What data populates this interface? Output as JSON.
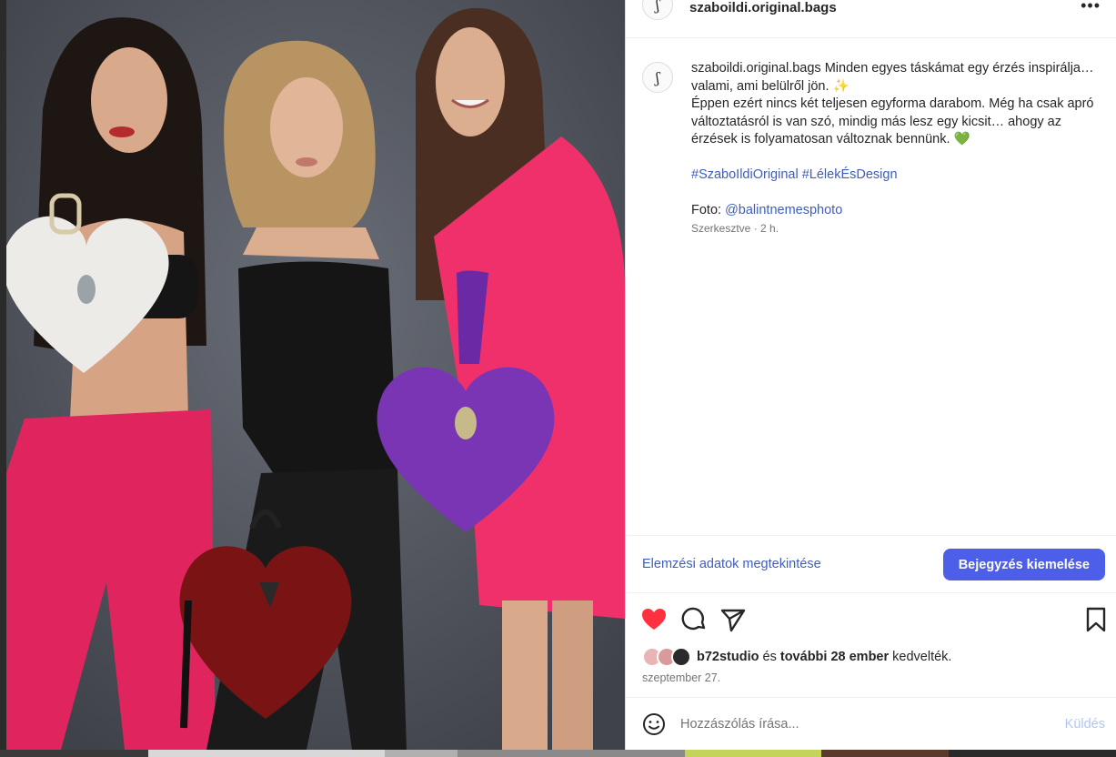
{
  "post": {
    "username": "szaboildi.original.bags",
    "avatar_glyph": "ʃ",
    "more_icon": "more-horizontal-icon"
  },
  "caption": {
    "username": "szaboildi.original.bags",
    "line1": "Minden egyes táskámat egy érzés inspirálja… valami, ami belülről jön. ✨",
    "line2": "Éppen ezért nincs két teljesen egyforma darabom. Még ha csak apró változtatásról is van szó, mindig más lesz egy kicsit… ahogy az érzések is folyamatosan változnak bennünk. 💚",
    "hashtag1": "#SzaboIldiOriginal",
    "hashtag2": "#LélekÉsDesign",
    "photo_prefix": "Foto:",
    "photo_credit": "@balintnemesphoto",
    "edited": "Szerkesztve",
    "sep": "·",
    "time_ago": "2 h."
  },
  "insights": {
    "view_label": "Elemzési adatok megtekintése",
    "boost_label": "Bejegyzés kiemelése"
  },
  "actions": {
    "like_icon": "heart-filled-icon",
    "comment_icon": "comment-icon",
    "share_icon": "send-icon",
    "save_icon": "bookmark-icon",
    "liked_color": "#ff3040"
  },
  "likes": {
    "first_user": "b72studio",
    "connector": "és",
    "others": "további 28 ember",
    "suffix": "kedvelték."
  },
  "date": "szeptember 27.",
  "comment": {
    "placeholder": "Hozzászólás írása...",
    "send_label": "Küldés"
  },
  "colors": {
    "link": "#3e5dbd",
    "boost_bg": "#4d5ee8"
  }
}
